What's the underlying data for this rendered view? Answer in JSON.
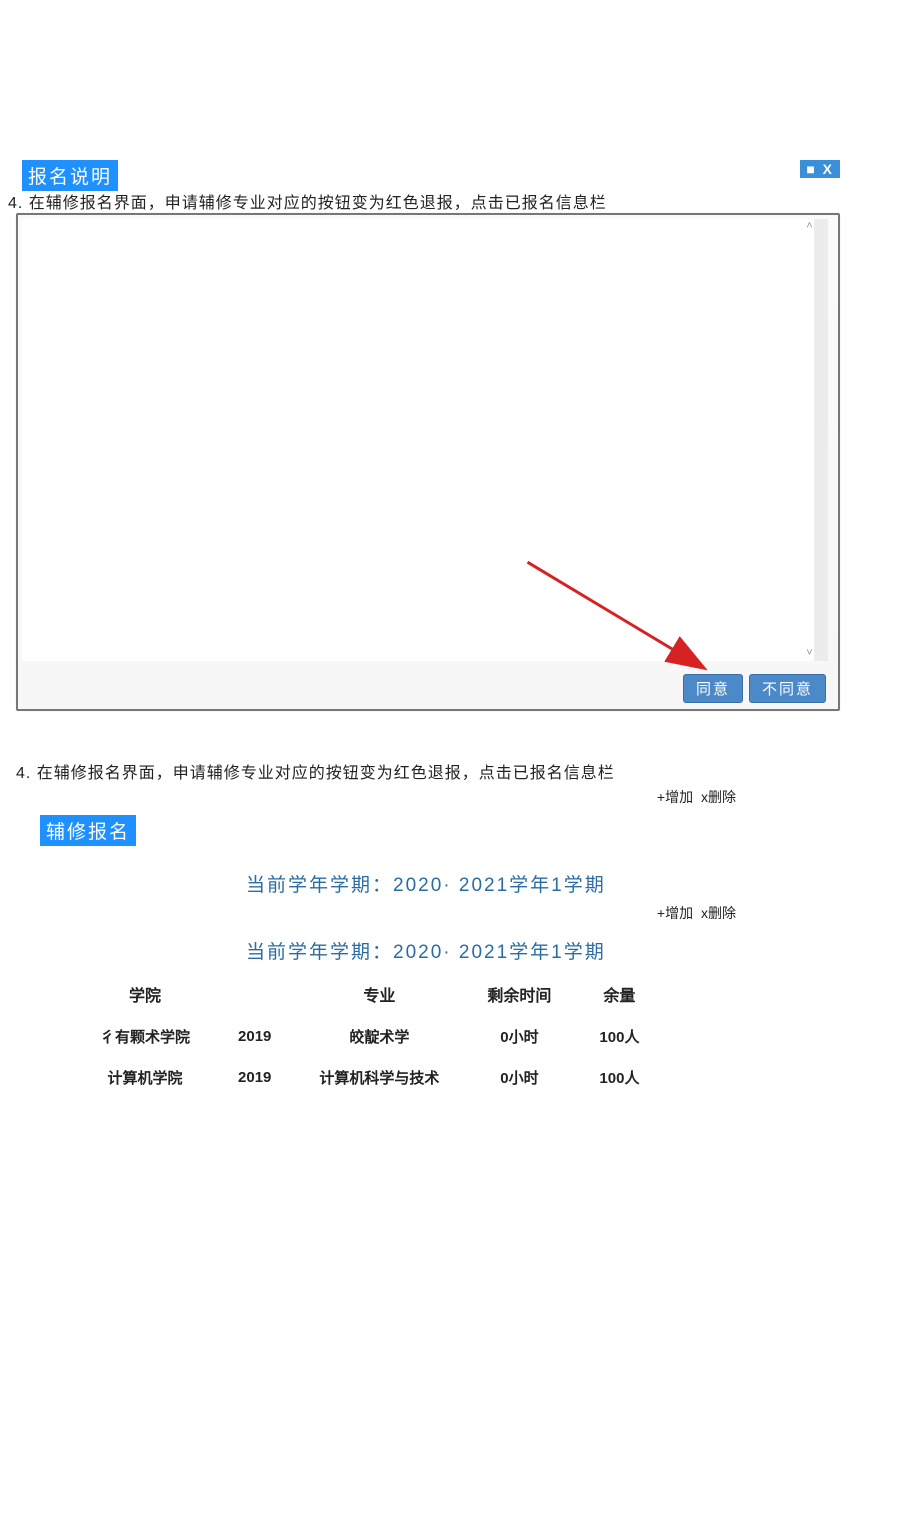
{
  "dialog": {
    "title_tag": "报名说明",
    "top_step": "4. 在辅修报名界面，申请辅修专业对应的按钮变为红色退报，点击已报名信息栏",
    "window_icons": "■ X",
    "agree": "同意",
    "disagree": "不同意"
  },
  "section2": {
    "step": "4. 在辅修报名界面，申请辅修专业对应的按钮变为红色退报，点击已报名信息栏",
    "title_tag": "辅修报名",
    "toolbar_add": "+增加",
    "toolbar_del": "x删除",
    "term1": "当前学年学期：2020·  2021学年1学期",
    "term2": "当前学年学期：2020·  2021学年1学期",
    "headers": {
      "college": "学院",
      "major": "专业",
      "time": "剩余时间",
      "quota": "余量"
    },
    "rows": [
      {
        "college": "彳有颗术学院",
        "year": "2019",
        "major": "皎靛术学",
        "time": "0小时",
        "quota": "100人"
      },
      {
        "college": "计算机学院",
        "year": "2019",
        "major": "计算机科学与技术",
        "time": "0小时",
        "quota": "100人"
      }
    ]
  }
}
